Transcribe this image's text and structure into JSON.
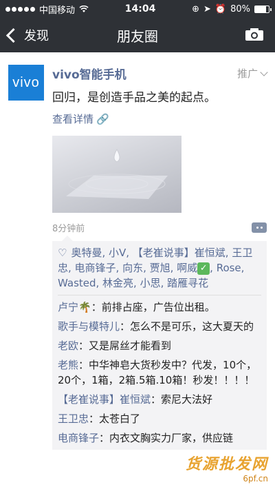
{
  "statusbar": {
    "carrier": "中国移动",
    "time": "14:04",
    "battery": "80%",
    "battery_level": 0.8
  },
  "navbar": {
    "back_label": "发现",
    "title": "朋友圈"
  },
  "post": {
    "logo_text": "vivo",
    "author": "vivo智能手机",
    "ad_label": "推广",
    "text": "回归，是创造手品之美的起点。",
    "detail_link": "查看详情",
    "time": "8分钟前"
  },
  "likes": {
    "names": "奥特曼, 小V, 【老崔说事】崔恒斌, 王卫忠, 电商锋子, 向东, 贾旭, 啊威",
    "names_after": ", Rose, Wasted, 林金亮, 小思, 踏雁寻花"
  },
  "comments": [
    {
      "name": "卢宁🌴",
      "text": "前排占座，广告位出租。"
    },
    {
      "name": "歌手与模特儿",
      "text": "怎么不是可乐，这大夏天的"
    },
    {
      "name": "老欧",
      "text": "又是屌丝才能看到"
    },
    {
      "name": "老熊",
      "text": "中华神皂大货秒发中？代发，10个，20个，1箱，2箱.5箱.10箱！秒发！！！！"
    },
    {
      "name": "【老崔说事】崔恒斌",
      "text": "索尼大法好"
    },
    {
      "name": "王卫忠",
      "text": "太苍白了"
    },
    {
      "name": "电商锋子",
      "text": "内衣文胸实力厂家，供应链"
    }
  ],
  "watermark": {
    "big": "货源批发网",
    "small": "6pf.cn"
  }
}
